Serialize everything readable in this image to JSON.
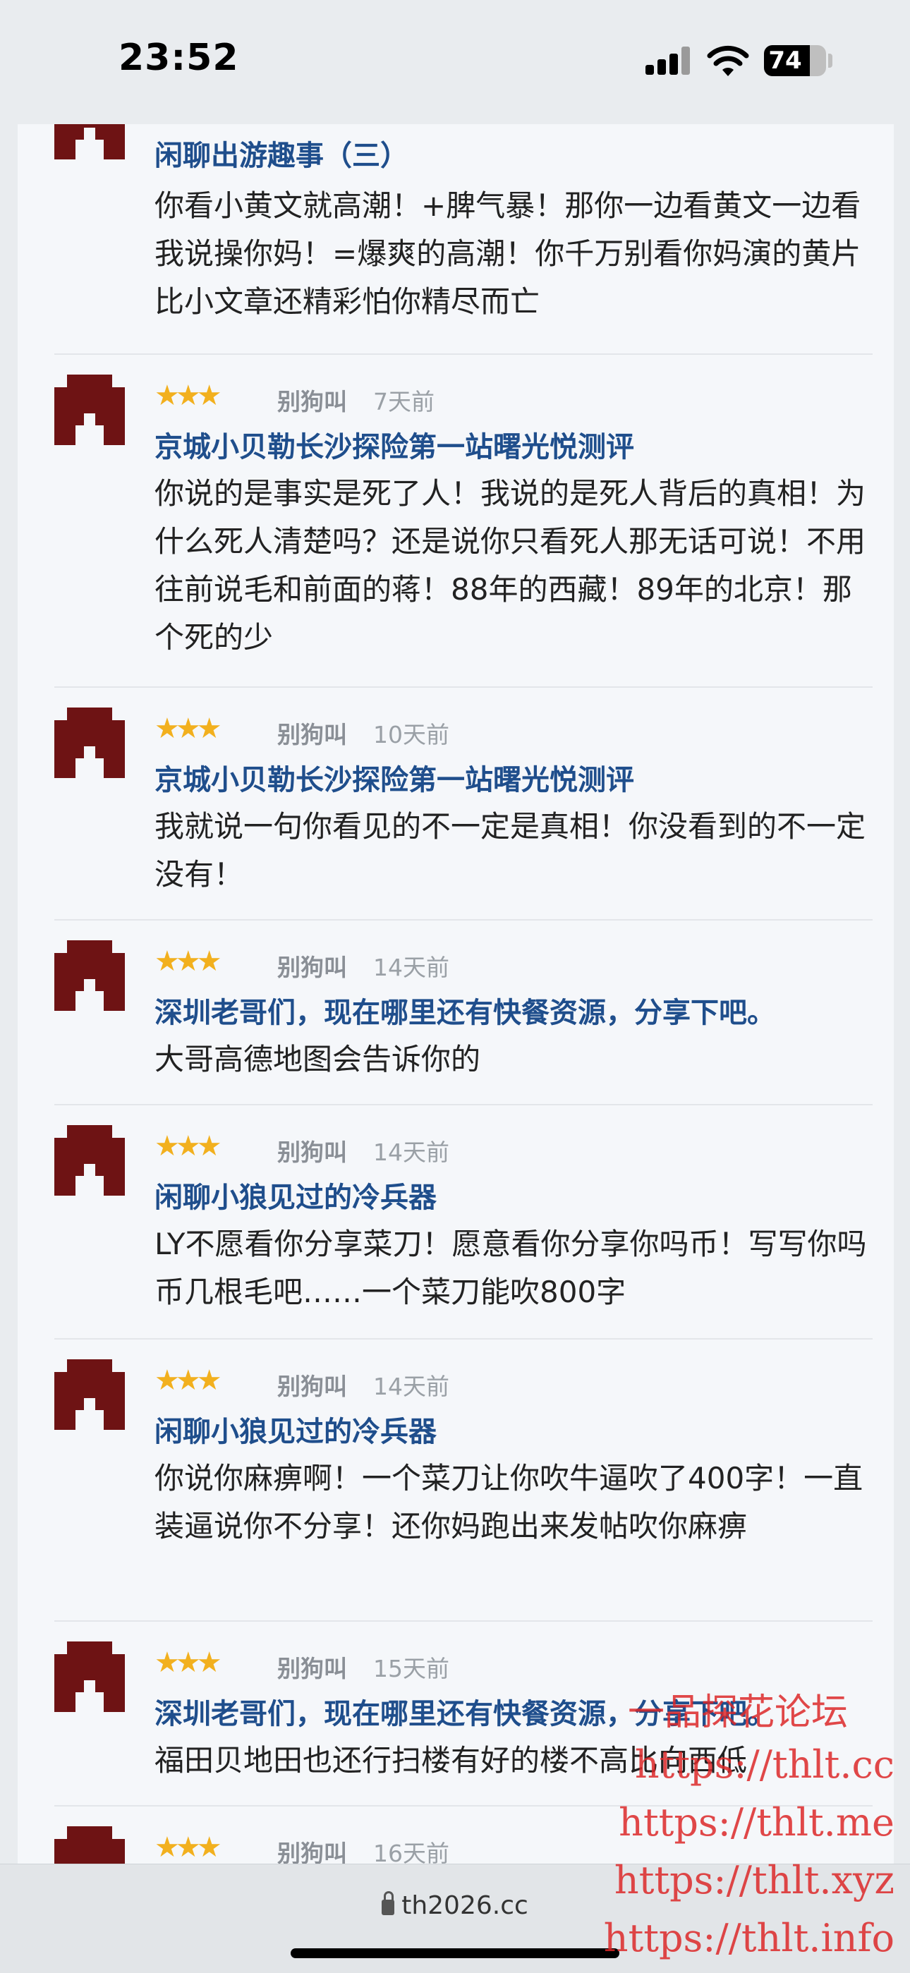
{
  "status_bar": {
    "time": "23:52",
    "battery": "74",
    "battery_level": 0.74
  },
  "rating_glyph": "★★★",
  "comments": [
    {
      "author": "",
      "time": "",
      "thread": "闲聊出游趣事（三）",
      "text": "你看小黄文就高潮！+脾气暴！那你一边看黄文一边看我说操你妈！=爆爽的高潮！你千万别看你妈演的黄片比小文章还精彩怕你精尽而亡"
    },
    {
      "author": "别狗叫",
      "time": "7天前",
      "thread": "京城小贝勒长沙探险第一站曙光悦测评",
      "text": "你说的是事实是死了人！我说的是死人背后的真相！为什么死人清楚吗？还是说你只看死人那无话可说！不用往前说毛和前面的蒋！88年的西藏！89年的北京！那个死的少"
    },
    {
      "author": "别狗叫",
      "time": "10天前",
      "thread": "京城小贝勒长沙探险第一站曙光悦测评",
      "text": "我就说一句你看见的不一定是真相！你没看到的不一定没有！"
    },
    {
      "author": "别狗叫",
      "time": "14天前",
      "thread": "深圳老哥们，现在哪里还有快餐资源，分享下吧。",
      "text": "大哥高德地图会告诉你的"
    },
    {
      "author": "别狗叫",
      "time": "14天前",
      "thread": "闲聊小狼见过的冷兵器",
      "text": "LY不愿看你分享菜刀！愿意看你分享你吗币！写写你吗币几根毛吧……一个菜刀能吹800字"
    },
    {
      "author": "别狗叫",
      "time": "14天前",
      "thread": "闲聊小狼见过的冷兵器",
      "text": "你说你麻痹啊！一个菜刀让你吹牛逼吹了400字！一直装逼说你不分享！还你妈跑出来发帖吹你麻痹"
    },
    {
      "author": "别狗叫",
      "time": "15天前",
      "thread": "深圳老哥们，现在哪里还有快餐资源，分享下吧。",
      "text": "福田贝地田也还行扫楼有好的楼不高比向西低"
    },
    {
      "author": "别狗叫",
      "time": "16天前",
      "thread": "",
      "text": ""
    }
  ],
  "bottom_bar": {
    "url": "th2026.cc"
  },
  "watermark": {
    "title": "一品探花论坛",
    "lines": [
      "https://thlt.cc",
      "https://thlt.me",
      "https://thlt.xyz",
      "https://thlt.info"
    ]
  },
  "colors": {
    "avatar": "#6e1314",
    "thread_link": "#1f4e8c",
    "star": "#f2b01e",
    "watermark": "#dc2828"
  }
}
